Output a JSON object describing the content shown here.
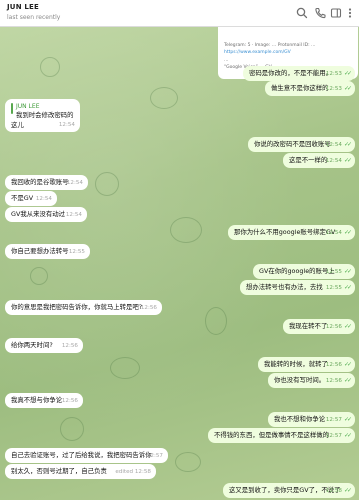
{
  "header": {
    "title": "JUN LEE",
    "status": "last seen recently"
  },
  "icons": [
    "search-icon",
    "phone-icon",
    "layout-icon",
    "more-icon"
  ],
  "colors": {
    "incoming": "#ffffff",
    "outgoing": "#effdde",
    "accent": "#58a84e",
    "check": "#4fae4e"
  },
  "attachment": {
    "lines": [
      "Telegram: 5 · Image: … Protonmail ID: …",
      "https://www.example.com/GV",
      "…",
      "“Google Voice” … GV …"
    ]
  },
  "messages": [
    {
      "dir": "out",
      "text": "密码是你改的，不是不能用。",
      "time": "12:53"
    },
    {
      "dir": "out",
      "text": "做生意不是你这样的",
      "time": "12:53"
    },
    {
      "dir": "in",
      "reply_name": "JUN LEE",
      "reply_text": "我到时会修改密码的",
      "text": "这儿",
      "time": "12:54"
    },
    {
      "dir": "out",
      "text": "你说的改密码不是回收账号",
      "time": "12:54"
    },
    {
      "dir": "out",
      "text": "这是不一样的",
      "time": "12:54"
    },
    {
      "dir": "in",
      "text": "我回收的是谷歌账号",
      "time": "12:54"
    },
    {
      "dir": "in",
      "text": "不是GV",
      "time": "12:54"
    },
    {
      "dir": "in",
      "text": "GV我从来没有动过",
      "time": "12:54"
    },
    {
      "dir": "out",
      "text": "那你为什么不用google账号绑定GV",
      "time": "12:54"
    },
    {
      "dir": "in",
      "text": "你自己要想办法转号",
      "time": "12:55"
    },
    {
      "dir": "out",
      "text": "GV在你的google的账号上",
      "time": "12:55"
    },
    {
      "dir": "out",
      "text": "想办法转号也有办法，去找",
      "time": "12:55"
    },
    {
      "dir": "in",
      "text": "你的意思是我把密码告诉你，你就马上转是吧?",
      "time": "12:56"
    },
    {
      "dir": "out",
      "text": "我现在转不了",
      "time": "12:56"
    },
    {
      "dir": "in",
      "text": "给你两天时间?",
      "time": "12:56"
    },
    {
      "dir": "out",
      "text": "我能转的时候，就转了",
      "time": "12:56"
    },
    {
      "dir": "out",
      "text": "你也没有写时间。",
      "time": "12:56"
    },
    {
      "dir": "in",
      "text": "我真不想与你争论",
      "time": "12:56"
    },
    {
      "dir": "out",
      "text": "我也不想和你争论",
      "time": "12:57"
    },
    {
      "dir": "out",
      "text": "不得钱的东西，但是做事情不是这样做的",
      "time": "12:57"
    },
    {
      "dir": "in",
      "text": "自己去验证账号，过了后给我说，我把密码告诉你",
      "time": "12:57"
    },
    {
      "dir": "in",
      "text": "别太久，否则号过期了，自己负责",
      "time": "12:58",
      "edited": "edited"
    },
    {
      "dir": "out",
      "text": "这又是到收了，卖你只是GV了，不说了",
      "time": "12:58"
    }
  ]
}
